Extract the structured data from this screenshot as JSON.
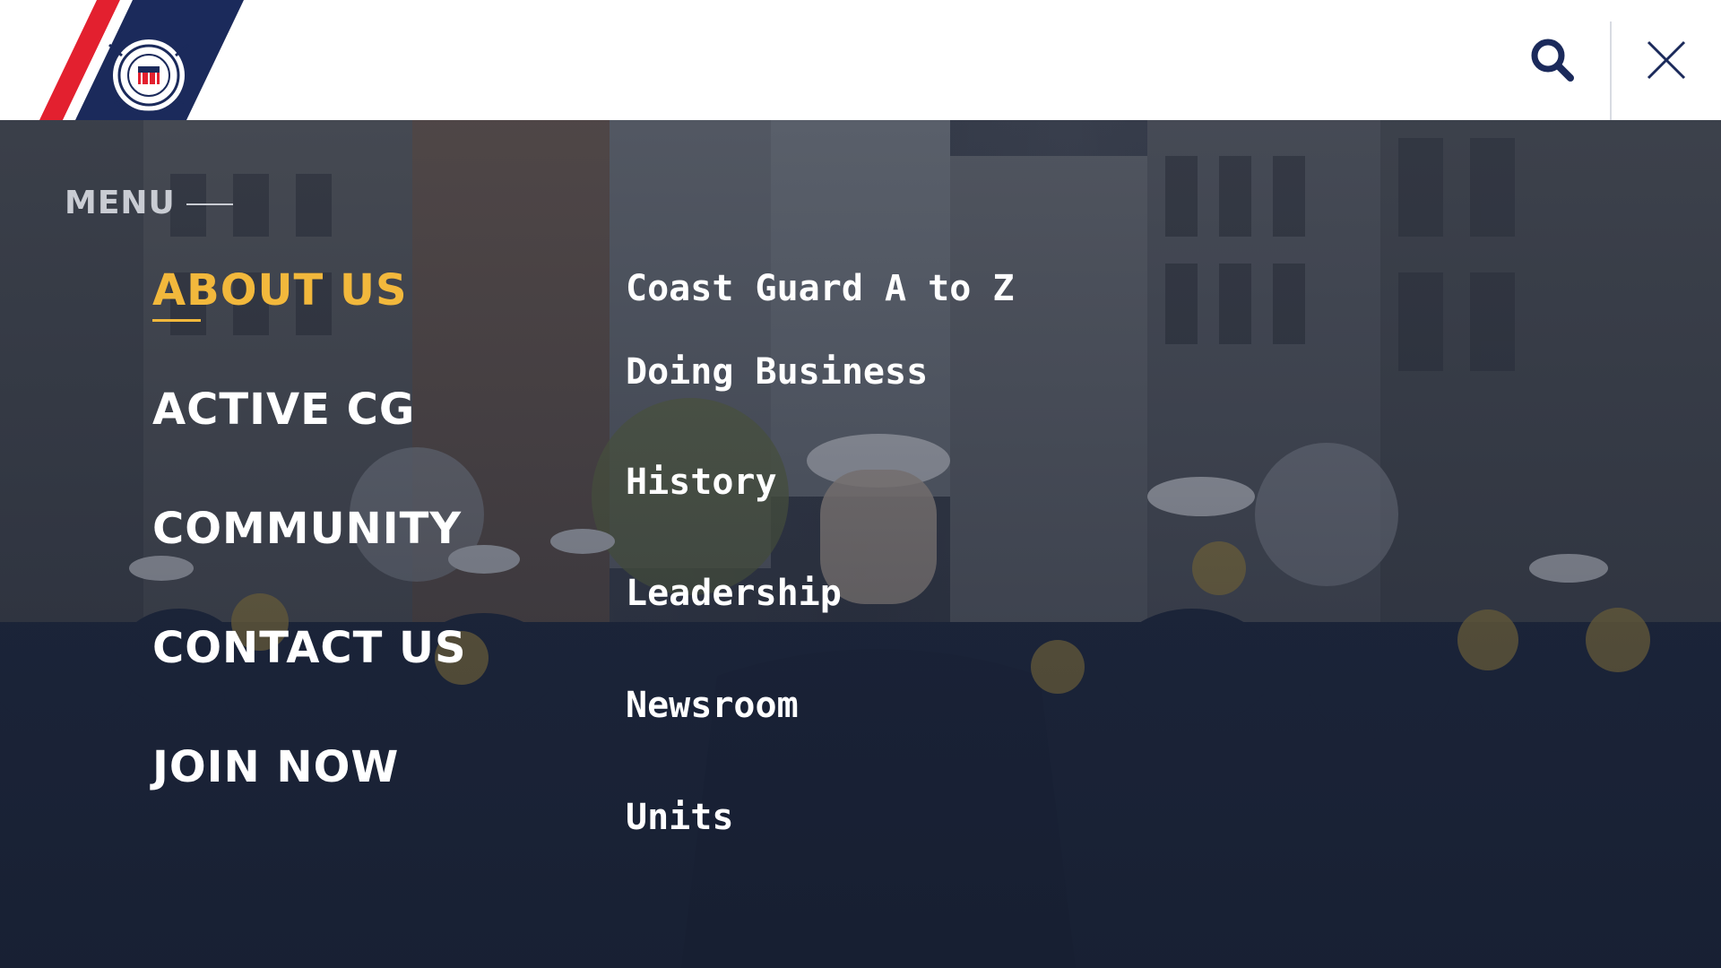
{
  "header": {
    "logo_alt": "U.S. Coast Guard",
    "search_icon": "search-icon",
    "close_icon": "close-icon",
    "colors": {
      "navy": "#1b2a5b",
      "red": "#e3202f",
      "white": "#ffffff"
    }
  },
  "menu": {
    "label": "MENU",
    "primary": [
      {
        "label": "ABOUT US",
        "active": true
      },
      {
        "label": "ACTIVE CG",
        "active": false
      },
      {
        "label": "COMMUNITY",
        "active": false
      },
      {
        "label": "CONTACT US",
        "active": false
      },
      {
        "label": "JOIN NOW",
        "active": false
      }
    ],
    "secondary": [
      {
        "label": "Coast Guard A to Z"
      },
      {
        "label": "Doing Business"
      },
      {
        "label": "History"
      },
      {
        "label": "Leadership"
      },
      {
        "label": "Newsroom"
      },
      {
        "label": "Units"
      }
    ],
    "active_color": "#f2b83c"
  }
}
